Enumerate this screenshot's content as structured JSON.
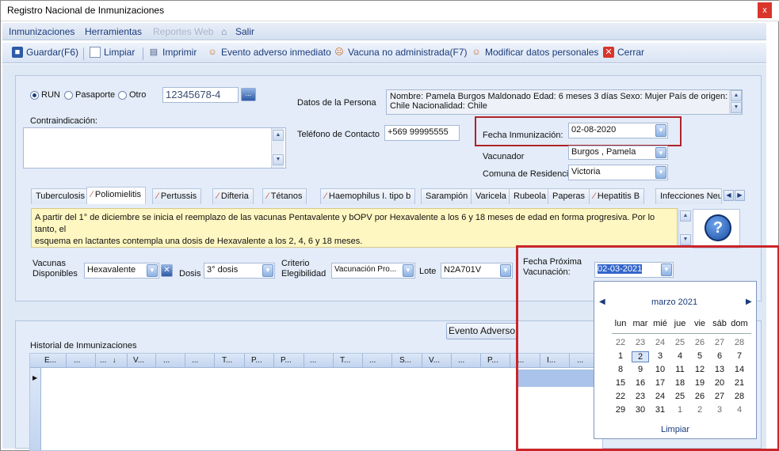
{
  "window": {
    "title": "Registro Nacional de Inmunizaciones",
    "close_label": "x"
  },
  "menu": {
    "items": [
      "Inmunizaciones",
      "Herramientas",
      "Reportes Web",
      "Salir"
    ]
  },
  "toolbar": {
    "guardar": "Guardar(F6)",
    "limpiar": "Limpiar",
    "imprimir": "Imprimir",
    "evento": "Evento adverso inmediato",
    "vacuna_no": "Vacuna no administrada(F7)",
    "modificar": "Modificar datos personales",
    "cerrar": "Cerrar"
  },
  "id_type": {
    "options": [
      "RUN",
      "Pasaporte",
      "Otro"
    ],
    "selected": "RUN",
    "value": "12345678-4",
    "lookup_label": "..."
  },
  "persona": {
    "label": "Datos de la Persona",
    "line1": "Nombre: Pamela  Burgos Maldonado  Edad: 6 meses 3 días  Sexo: Mujer País de origen:",
    "line2": "Chile Nacionalidad: Chile"
  },
  "contraindicacion": {
    "label": "Contraindicación:",
    "value": ""
  },
  "telefono": {
    "label": "Teléfono de Contacto",
    "value": "+569 99995555"
  },
  "fecha_inmunizacion": {
    "label": "Fecha Inmunización:",
    "value": "02-08-2020"
  },
  "vacunador": {
    "label": "Vacunador",
    "value": "Burgos , Pamela"
  },
  "comuna": {
    "label": "Comuna de Residencia",
    "value": "Victoria"
  },
  "tabs": [
    {
      "label": "Tuberculosis"
    },
    {
      "label": "Poliomielitis"
    },
    {
      "label": "Pertussis"
    },
    {
      "label": "Difteria"
    },
    {
      "label": "Tétanos"
    },
    {
      "label": "Haemophilus I. tipo b"
    },
    {
      "label": "Sarampión"
    },
    {
      "label": "Varicela"
    },
    {
      "label": "Rubeola"
    },
    {
      "label": "Paperas"
    },
    {
      "label": "Hepatitis B"
    },
    {
      "label": "Infecciones Neu"
    }
  ],
  "info": {
    "line1": "A partir del 1° de diciembre se inicia el reemplazo de las vacunas Pentavalente y bOPV por Hexavalente a los 6 y 18 meses de edad en forma progresiva. Por lo tanto, el",
    "line2": "esquema en lactantes contempla una dosis de Hexavalente a los 2, 4, 6 y 18 meses."
  },
  "vacunas": {
    "label1": "Vacunas",
    "label2": "Disponibles",
    "value": "Hexavalente"
  },
  "dosis": {
    "label": "Dosis",
    "value": "3° dosis"
  },
  "criterio": {
    "label1": "Criterio",
    "label2": "Elegibilidad",
    "value": "Vacunación Pro..."
  },
  "lote": {
    "label": "Lote",
    "value": "N2A701V"
  },
  "fecha_proxima": {
    "label1": "Fecha Próxima",
    "label2": "Vacunación:",
    "value": "02-03-2021"
  },
  "evento_adverso_btn": "Evento Adverso",
  "historial": {
    "label": "Historial de Inmunizaciones",
    "columns": [
      "E...",
      "...",
      "...",
      "V...",
      "...",
      "...",
      "T...",
      "P...",
      "P...",
      "...",
      "T...",
      "...",
      "S...",
      "V...",
      "...",
      "P...",
      "...",
      "I...",
      "..."
    ]
  },
  "calendar": {
    "month": "marzo 2021",
    "weekdays": [
      "lun",
      "mar",
      "mié",
      "jue",
      "vie",
      "sáb",
      "dom"
    ],
    "weeks": [
      [
        "22",
        "23",
        "24",
        "25",
        "26",
        "27",
        "28"
      ],
      [
        "1",
        "2",
        "3",
        "4",
        "5",
        "6",
        "7"
      ],
      [
        "8",
        "9",
        "10",
        "11",
        "12",
        "13",
        "14"
      ],
      [
        "15",
        "16",
        "17",
        "18",
        "19",
        "20",
        "21"
      ],
      [
        "22",
        "23",
        "24",
        "25",
        "26",
        "27",
        "28"
      ],
      [
        "29",
        "30",
        "31",
        "1",
        "2",
        "3",
        "4"
      ]
    ],
    "selected_day": "2",
    "clear_label": "Limpiar"
  },
  "colors": {
    "highlight_red": "#c8262b",
    "info_bg": "#fff7c2",
    "panel_bg": "#e3ecf8"
  }
}
